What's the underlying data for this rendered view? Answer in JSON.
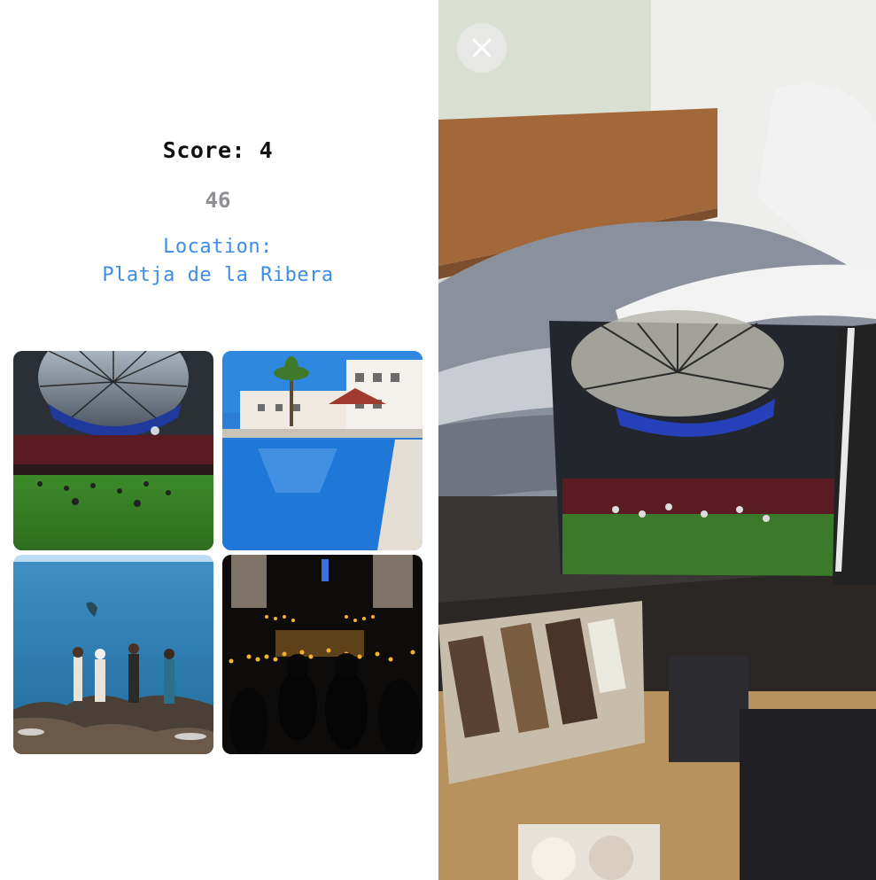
{
  "game": {
    "score_text": "Score: 4",
    "timer": "46",
    "location_label": "Location:",
    "location_name": "Platja de la Ribera"
  },
  "photo_grid": [
    {
      "icon": "stadium-photo"
    },
    {
      "icon": "pool-photo"
    },
    {
      "icon": "seaside-rocks-photo"
    },
    {
      "icon": "candlelight-concert-photo"
    }
  ],
  "ar_view": {
    "close_icon": "close-icon"
  },
  "colors": {
    "accent": "#3b8de8",
    "timer_gray": "#8e8e93"
  }
}
